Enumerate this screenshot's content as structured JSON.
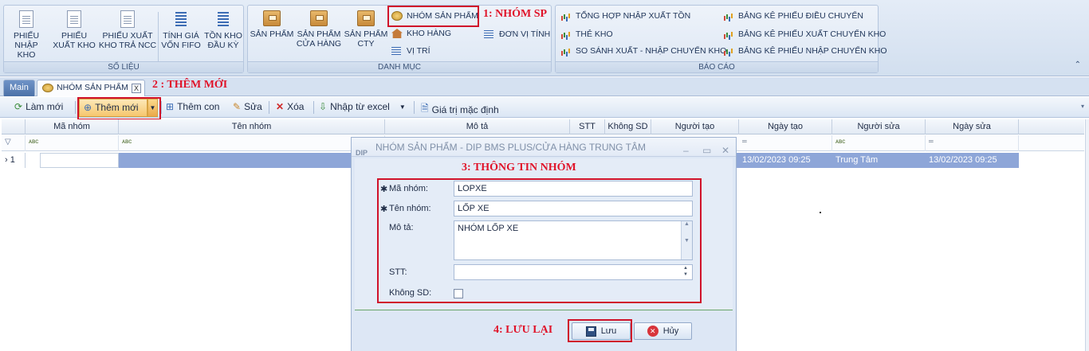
{
  "ribbon": {
    "so_lieu": {
      "label": "SỐ LIỆU",
      "buttons": [
        {
          "line1": "PHIẾU",
          "line2": "NHẬP KHO"
        },
        {
          "line1": "PHIẾU",
          "line2": "XUẤT KHO"
        },
        {
          "line1": "PHIẾU XUẤT",
          "line2": "KHO TRẢ NCC"
        },
        {
          "line1": "TÍNH GIÁ",
          "line2": "VỐN FIFO"
        },
        {
          "line1": "TỒN KHO",
          "line2": "ĐẦU KỲ"
        }
      ]
    },
    "danh_muc": {
      "label": "DANH MỤC",
      "buttons": [
        {
          "line1": "SẢN PHẨM",
          "line2": ""
        },
        {
          "line1": "SẢN PHẨM",
          "line2": "CỬA HÀNG"
        },
        {
          "line1": "SẢN PHẨM",
          "line2": "CTY"
        }
      ],
      "small": [
        "NHÓM SẢN PHẨM",
        "KHO HÀNG",
        "VỊ TRÍ",
        "ĐƠN VỊ TÍNH"
      ]
    },
    "bao_cao": {
      "label": "BÁO CÁO",
      "items": [
        "TỔNG HỢP NHẬP XUẤT TỒN",
        "THẺ KHO",
        "SO SÁNH XUẤT - NHẬP CHUYỂN KHO",
        "BẢNG KÊ PHIẾU ĐIỀU CHUYỂN",
        "BẢNG KÊ PHIẾU XUẤT CHUYỂN KHO",
        "BẢNG KÊ PHIẾU NHẬP CHUYỂN KHO"
      ]
    }
  },
  "annotations": {
    "step1": "1: NHÓM SP",
    "step2": "2 : THÊM MỚI",
    "step3": "3: THÔNG TIN NHÓM",
    "step4": "4: LƯU LẠI"
  },
  "tabs": {
    "main": "Main",
    "active": "NHÓM SẢN PHẨM",
    "close": "x"
  },
  "toolbar": {
    "refresh": "Làm mới",
    "add": "Thêm mới",
    "add_child": "Thêm con",
    "edit": "Sửa",
    "delete": "Xóa",
    "import": "Nhập từ excel",
    "defaults": "Giá trị mặc định"
  },
  "grid": {
    "columns": [
      "Mã nhóm",
      "Tên nhóm",
      "Mô tả",
      "STT",
      "Không SD",
      "Người tạo",
      "Ngày tạo",
      "Người sửa",
      "Ngày sửa"
    ],
    "row_number": "1",
    "row": {
      "ngay_tao": "13/02/2023 09:25",
      "nguoi_sua": "Trung Tâm",
      "ngay_sua": "13/02/2023 09:25"
    }
  },
  "dialog": {
    "title": "NHÓM SẢN PHẨM - DIP BMS Plus/Cửa Hàng Trung Tâm",
    "logo": "DIP",
    "labels": {
      "ma_nhom": "Mã nhóm:",
      "ten_nhom": "Tên nhóm:",
      "mo_ta": "Mô tả:",
      "stt": "STT:",
      "khong_sd": "Không SD:"
    },
    "values": {
      "ma_nhom": "LOPXE",
      "ten_nhom": "LỐP XE",
      "mo_ta": "NHÓM LỐP XE",
      "stt": ""
    },
    "save": "Lưu",
    "cancel": "Hủy"
  }
}
